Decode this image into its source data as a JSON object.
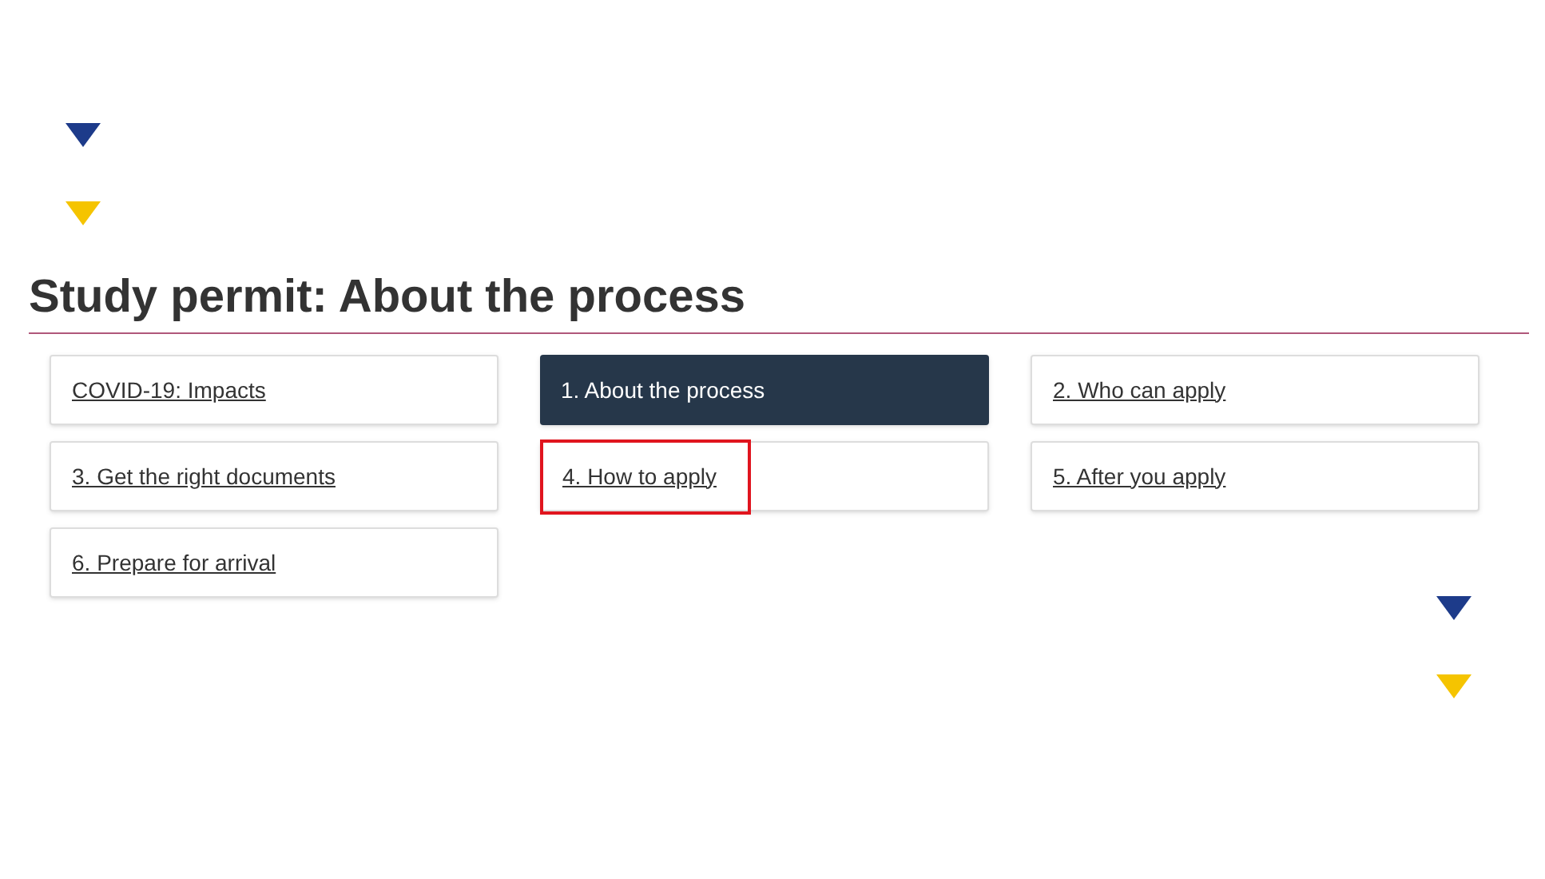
{
  "title": "Study permit: About the process",
  "links": [
    {
      "label": "COVID-19: Impacts",
      "selected": false,
      "highlighted": false
    },
    {
      "label": "1. About the process",
      "selected": true,
      "highlighted": false
    },
    {
      "label": "2. Who can apply",
      "selected": false,
      "highlighted": false
    },
    {
      "label": "3. Get the right documents",
      "selected": false,
      "highlighted": false
    },
    {
      "label": "4. How to apply",
      "selected": false,
      "highlighted": true
    },
    {
      "label": "5. After you apply",
      "selected": false,
      "highlighted": false
    },
    {
      "label": "6. Prepare for arrival",
      "selected": false,
      "highlighted": false
    }
  ]
}
